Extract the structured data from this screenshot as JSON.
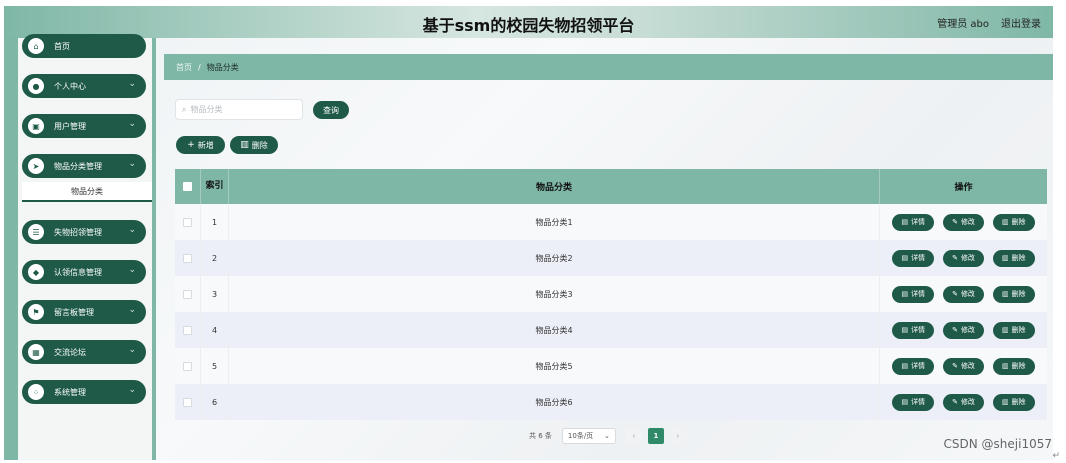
{
  "header": {
    "title": "基于ssm的校园失物招领平台",
    "user_label": "管理员 abo",
    "logout_label": "退出登录"
  },
  "sidebar": {
    "items": [
      {
        "label": "首页",
        "icon": "home-icon",
        "glyph": "⌂"
      },
      {
        "label": "个人中心",
        "icon": "person-icon",
        "glyph": "●"
      },
      {
        "label": "用户管理",
        "icon": "user-badge-icon",
        "glyph": "▣"
      },
      {
        "label": "物品分类管理",
        "icon": "send-icon",
        "glyph": "➤"
      },
      {
        "label": "失物招领管理",
        "icon": "sliders-icon",
        "glyph": "☰"
      },
      {
        "label": "认领信息管理",
        "icon": "shield-icon",
        "glyph": "◆"
      },
      {
        "label": "留言板管理",
        "icon": "flag-icon",
        "glyph": "⚑"
      },
      {
        "label": "交流论坛",
        "icon": "grid-icon",
        "glyph": "▦"
      },
      {
        "label": "系统管理",
        "icon": "apps-icon",
        "glyph": "⁘"
      }
    ],
    "sub_item": "物品分类"
  },
  "breadcrumb": {
    "home": "首页",
    "separator": "/",
    "current": "物品分类"
  },
  "search": {
    "placeholder": "物品分类",
    "button": "查询"
  },
  "actions": {
    "add": "新增",
    "delete": "删除"
  },
  "table": {
    "headers": {
      "index": "索引",
      "category": "物品分类",
      "operation": "操作"
    },
    "rows": [
      {
        "index": "1",
        "category": "物品分类1"
      },
      {
        "index": "2",
        "category": "物品分类2"
      },
      {
        "index": "3",
        "category": "物品分类3"
      },
      {
        "index": "4",
        "category": "物品分类4"
      },
      {
        "index": "5",
        "category": "物品分类5"
      },
      {
        "index": "6",
        "category": "物品分类6"
      }
    ],
    "op_labels": {
      "detail": "详情",
      "edit": "修改",
      "delete": "删除"
    }
  },
  "pagination": {
    "total": "共 6 条",
    "page_size": "10条/页",
    "current_page": "1"
  },
  "watermark": "CSDN @sheji1057",
  "colors": {
    "primary": "#1f5a48",
    "accent": "#7fb7a6"
  }
}
